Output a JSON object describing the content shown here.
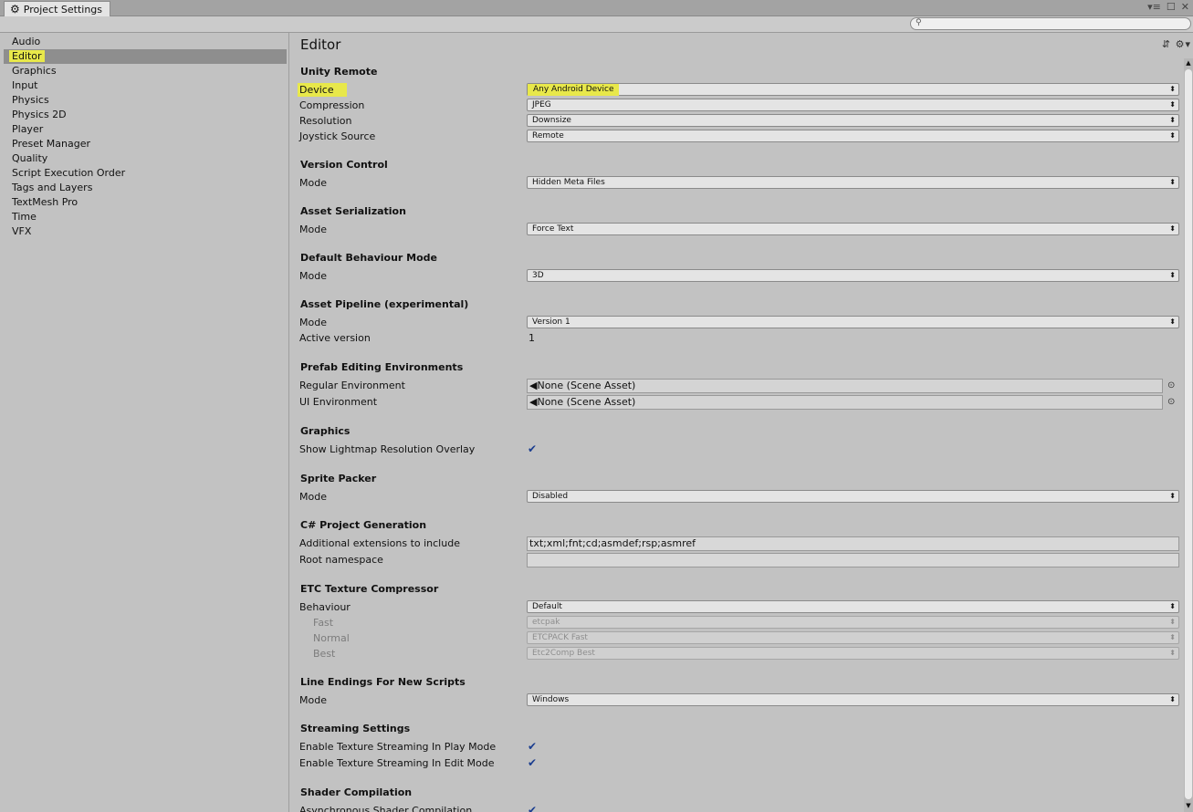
{
  "window": {
    "tab_icon": "gear-icon",
    "tab_title": "Project Settings",
    "controls": [
      "▾≡",
      "☐",
      "✕"
    ]
  },
  "search": {
    "placeholder": "",
    "icon": "search-icon"
  },
  "sidebar": {
    "items": [
      {
        "label": "Audio"
      },
      {
        "label": "Editor",
        "selected": true
      },
      {
        "label": "Graphics"
      },
      {
        "label": "Input"
      },
      {
        "label": "Physics"
      },
      {
        "label": "Physics 2D"
      },
      {
        "label": "Player"
      },
      {
        "label": "Preset Manager"
      },
      {
        "label": "Quality"
      },
      {
        "label": "Script Execution Order"
      },
      {
        "label": "Tags and Layers"
      },
      {
        "label": "TextMesh Pro"
      },
      {
        "label": "Time"
      },
      {
        "label": "VFX"
      }
    ]
  },
  "main": {
    "title": "Editor",
    "header_icons": "⇵ ⚙▾",
    "unity_remote": {
      "heading": "Unity Remote",
      "device_label": "Device",
      "device_value": "Any Android Device",
      "compression_label": "Compression",
      "compression_value": "JPEG",
      "resolution_label": "Resolution",
      "resolution_value": "Downsize",
      "joystick_label": "Joystick Source",
      "joystick_value": "Remote"
    },
    "version_control": {
      "heading": "Version Control",
      "mode_label": "Mode",
      "mode_value": "Hidden Meta Files"
    },
    "asset_serialization": {
      "heading": "Asset Serialization",
      "mode_label": "Mode",
      "mode_value": "Force Text"
    },
    "default_behaviour": {
      "heading": "Default Behaviour Mode",
      "mode_label": "Mode",
      "mode_value": "3D"
    },
    "asset_pipeline": {
      "heading": "Asset Pipeline (experimental)",
      "mode_label": "Mode",
      "mode_value": "Version 1",
      "active_label": "Active version",
      "active_value": "1"
    },
    "prefab_env": {
      "heading": "Prefab Editing Environments",
      "regular_label": "Regular Environment",
      "regular_value": "None (Scene Asset)",
      "ui_label": "UI Environment",
      "ui_value": "None (Scene Asset)"
    },
    "graphics": {
      "heading": "Graphics",
      "lightmap_label": "Show Lightmap Resolution Overlay",
      "lightmap_checked": true
    },
    "sprite_packer": {
      "heading": "Sprite Packer",
      "mode_label": "Mode",
      "mode_value": "Disabled"
    },
    "csharp": {
      "heading": "C# Project Generation",
      "ext_label": "Additional extensions to include",
      "ext_value": "txt;xml;fnt;cd;asmdef;rsp;asmref",
      "ns_label": "Root namespace",
      "ns_value": ""
    },
    "etc": {
      "heading": "ETC Texture Compressor",
      "behaviour_label": "Behaviour",
      "behaviour_value": "Default",
      "fast_label": "Fast",
      "fast_value": "etcpak",
      "normal_label": "Normal",
      "normal_value": "ETCPACK Fast",
      "best_label": "Best",
      "best_value": "Etc2Comp Best"
    },
    "line_endings": {
      "heading": "Line Endings For New Scripts",
      "mode_label": "Mode",
      "mode_value": "Windows"
    },
    "streaming": {
      "heading": "Streaming Settings",
      "play_label": "Enable Texture Streaming In Play Mode",
      "play_checked": true,
      "edit_label": "Enable Texture Streaming In Edit Mode",
      "edit_checked": true
    },
    "shader": {
      "heading": "Shader Compilation",
      "async_label": "Asynchronous Shader Compilation",
      "async_checked": true
    }
  },
  "glyphs": {
    "dropdown_arrow": "⬍",
    "check": "✔",
    "object_picker": "⊙",
    "scene_icon": "◀"
  },
  "colors": {
    "highlight": "#e8e84a",
    "selected_row": "#8e8e8e",
    "background": "#c2c2c2"
  }
}
